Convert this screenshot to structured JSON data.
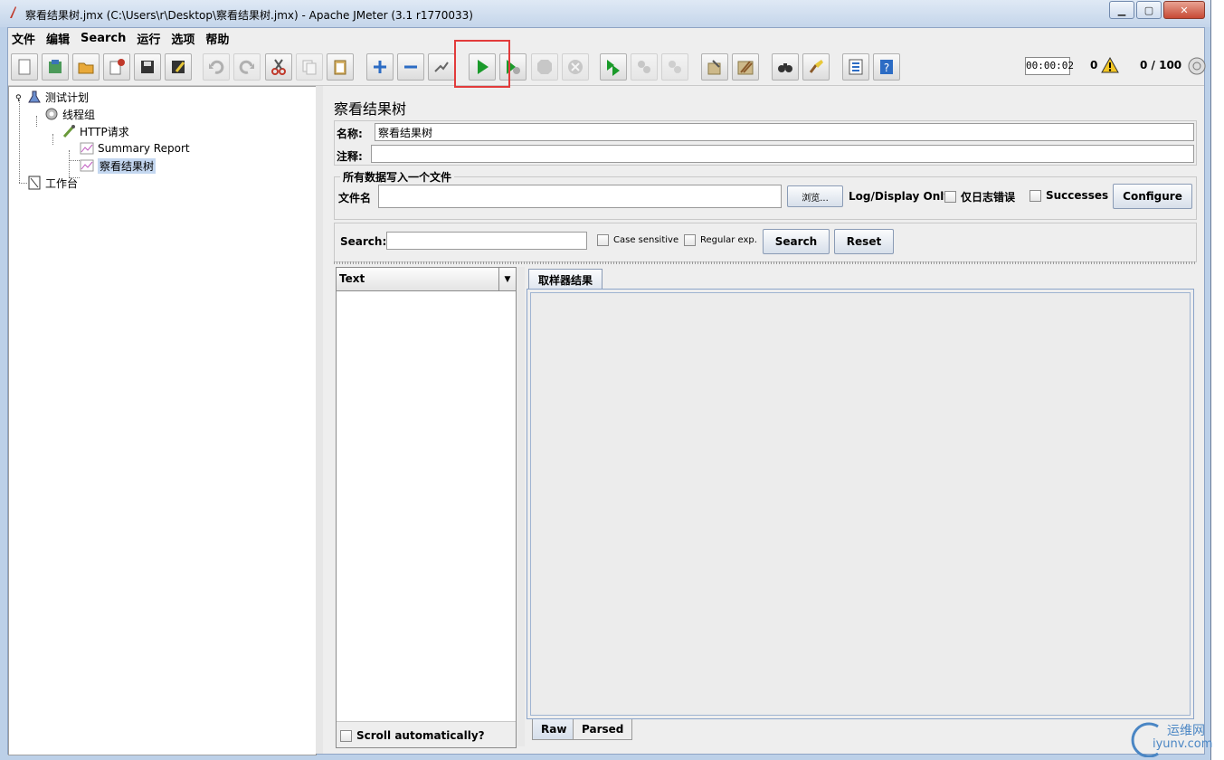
{
  "window": {
    "title": "察看结果树.jmx (C:\\Users\\r\\Desktop\\察看结果树.jmx) - Apache JMeter (3.1 r1770033)"
  },
  "menu": [
    "文件",
    "编辑",
    "Search",
    "运行",
    "选项",
    "帮助"
  ],
  "status": {
    "elapsed": "00:00:02",
    "errors": "0",
    "threads": "0 / 100"
  },
  "tree": {
    "test_plan": "测试计划",
    "thread_group": "线程组",
    "http_request": "HTTP请求",
    "summary_report": "Summary Report",
    "view_results_tree": "察看结果树",
    "workbench": "工作台"
  },
  "panel": {
    "title": "察看结果树",
    "name_label": "名称:",
    "name_value": "察看结果树",
    "comment_label": "注释:",
    "comment_value": "",
    "file_group_title": "所有数据写入一个文件",
    "filename_label": "文件名",
    "filename_value": "",
    "browse_button": "浏览...",
    "log_display_label": "Log/Display Only:",
    "errors_only_label": "仅日志错误",
    "successes_label": "Successes",
    "configure_button": "Configure"
  },
  "search": {
    "label": "Search:",
    "value": "",
    "case_sensitive": "Case sensitive",
    "regular_exp": "Regular exp.",
    "search_button": "Search",
    "reset_button": "Reset"
  },
  "results": {
    "renderer_selected": "Text",
    "scroll_auto_label": "Scroll automatically?",
    "tab_label": "取样器结果",
    "raw_tab": "Raw",
    "parsed_tab": "Parsed"
  },
  "watermark": {
    "line1": "运维网",
    "line2": "iyunv.com"
  }
}
